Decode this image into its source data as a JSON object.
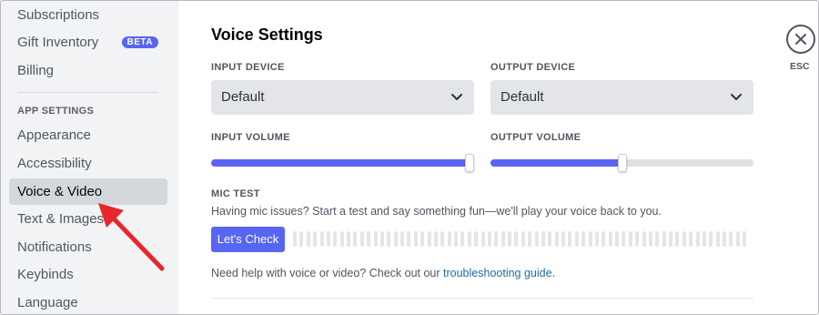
{
  "sidebar": {
    "items_top": [
      {
        "label": "Subscriptions"
      },
      {
        "label": "Gift Inventory",
        "badge": "BETA"
      },
      {
        "label": "Billing"
      }
    ],
    "section_header": "APP SETTINGS",
    "items_app": [
      {
        "label": "Appearance"
      },
      {
        "label": "Accessibility"
      },
      {
        "label": "Voice & Video",
        "active": true
      },
      {
        "label": "Text & Images"
      },
      {
        "label": "Notifications"
      },
      {
        "label": "Keybinds"
      },
      {
        "label": "Language"
      }
    ]
  },
  "main": {
    "title": "Voice Settings",
    "input_device": {
      "label": "INPUT DEVICE",
      "value": "Default"
    },
    "output_device": {
      "label": "OUTPUT DEVICE",
      "value": "Default"
    },
    "input_volume": {
      "label": "INPUT VOLUME",
      "level": 1.0
    },
    "output_volume": {
      "label": "OUTPUT VOLUME",
      "level": 0.5
    },
    "mic_test": {
      "label": "MIC TEST",
      "description": "Having mic issues? Start a test and say something fun—we'll play your voice back to you.",
      "button": "Let's Check"
    },
    "help": {
      "text": "Need help with voice or video? Check out our ",
      "link": "troubleshooting guide",
      "suffix": "."
    }
  },
  "close": {
    "label": "ESC",
    "icon": "close-icon"
  },
  "colors": {
    "accent": "#5865f2",
    "link": "#1f6ba8",
    "annotation_arrow": "#e8262b"
  }
}
